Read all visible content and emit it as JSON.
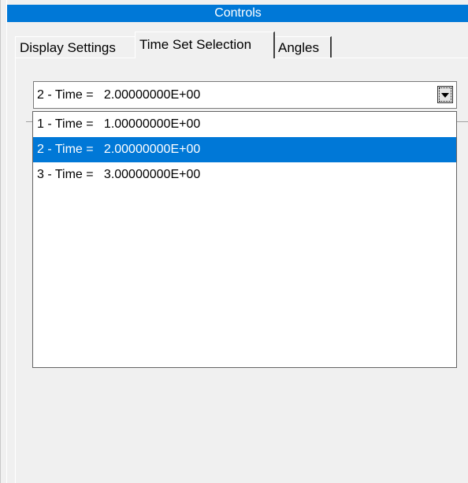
{
  "window": {
    "title": "Controls"
  },
  "tabs": [
    {
      "label": "Display Settings",
      "active": false
    },
    {
      "label": "Time Set Selection",
      "active": true
    },
    {
      "label": "Angles",
      "active": false
    }
  ],
  "time_set": {
    "selected_value": "2 - Time =   2.00000000E+00",
    "options": [
      {
        "label": "1 - Time =   1.00000000E+00",
        "selected": false
      },
      {
        "label": "2 - Time =   2.00000000E+00",
        "selected": true
      },
      {
        "label": "3 - Time =   3.00000000E+00",
        "selected": false
      }
    ]
  },
  "colors": {
    "accent": "#0078d7",
    "background": "#f0f0f0"
  },
  "icons": {
    "dropdown_button": "chevron-down-icon"
  }
}
